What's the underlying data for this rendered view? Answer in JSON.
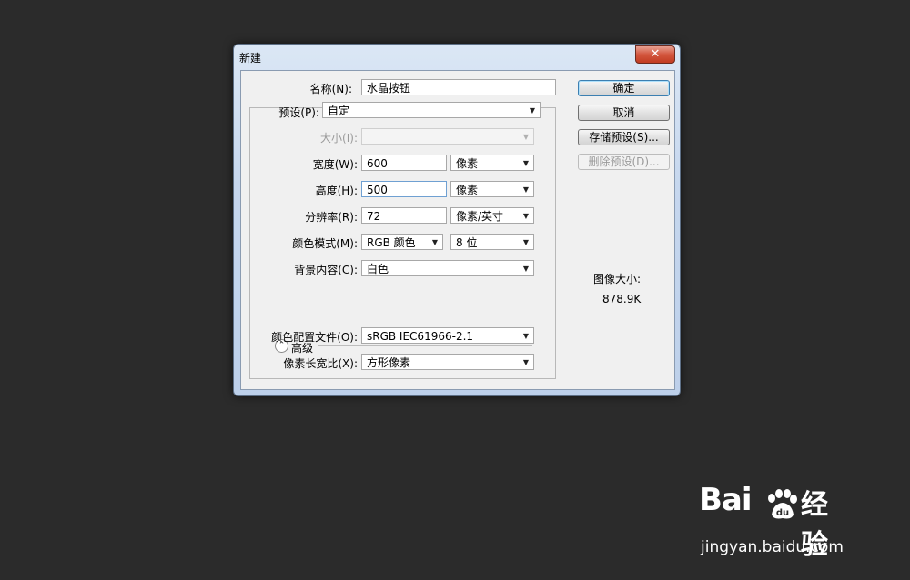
{
  "dialog": {
    "title": "新建",
    "close_glyph": "✕",
    "name": {
      "label": "名称(N):",
      "value": "水晶按钮"
    },
    "preset": {
      "label": "预设(P):",
      "value": "自定"
    },
    "size": {
      "label": "大小(I):",
      "value": ""
    },
    "width": {
      "label": "宽度(W):",
      "value": "600",
      "unit": "像素"
    },
    "height": {
      "label": "高度(H):",
      "value": "500",
      "unit": "像素"
    },
    "resolution": {
      "label": "分辨率(R):",
      "value": "72",
      "unit": "像素/英寸"
    },
    "color_mode": {
      "label": "颜色模式(M):",
      "value": "RGB 颜色",
      "depth": "8 位"
    },
    "background": {
      "label": "背景内容(C):",
      "value": "白色"
    },
    "advanced": {
      "label": "高级",
      "icon": "chevron-up-icon"
    },
    "color_profile": {
      "label": "颜色配置文件(O):",
      "value": "sRGB IEC61966-2.1"
    },
    "pixel_aspect": {
      "label": "像素长宽比(X):",
      "value": "方形像素"
    },
    "buttons": {
      "ok": "确定",
      "cancel": "取消",
      "save_preset": "存储预设(S)...",
      "delete_preset": "删除预设(D)..."
    },
    "image_size": {
      "label": "图像大小:",
      "value": "878.9K"
    }
  },
  "watermark": {
    "brand_left": "Bai",
    "brand_right": "经验",
    "url": "jingyan.baidu.com"
  }
}
